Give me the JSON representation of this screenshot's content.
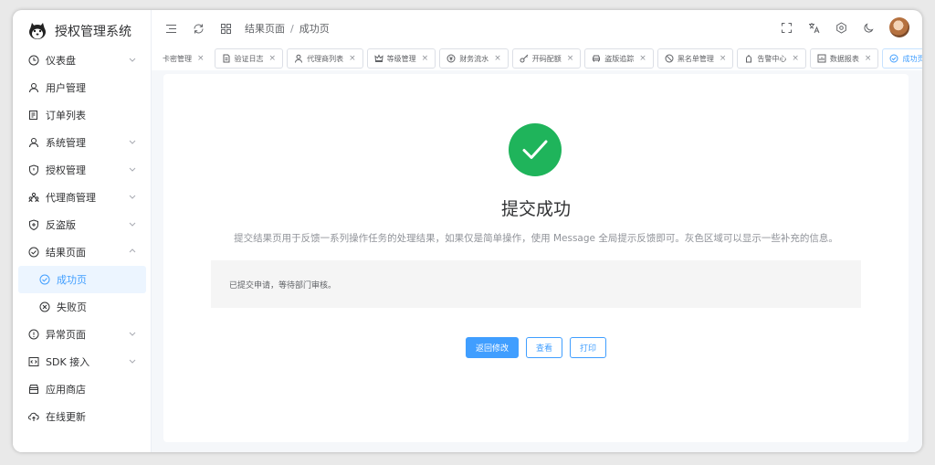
{
  "app": {
    "title": "授权管理系统"
  },
  "sidebar": {
    "items": [
      {
        "label": "仪表盘",
        "icon": "clock-icon",
        "arrow": "down"
      },
      {
        "label": "用户管理",
        "icon": "user-icon",
        "arrow": ""
      },
      {
        "label": "订单列表",
        "icon": "list-icon",
        "arrow": ""
      },
      {
        "label": "系统管理",
        "icon": "user-icon",
        "arrow": "down"
      },
      {
        "label": "授权管理",
        "icon": "shield-icon",
        "arrow": "down"
      },
      {
        "label": "代理商管理",
        "icon": "team-icon",
        "arrow": "down"
      },
      {
        "label": "反盗版",
        "icon": "shield-plus-icon",
        "arrow": "down"
      },
      {
        "label": "结果页面",
        "icon": "check-circle-icon",
        "arrow": "up"
      },
      {
        "label": "成功页",
        "icon": "check-circle-icon",
        "arrow": ""
      },
      {
        "label": "失败页",
        "icon": "close-circle-icon",
        "arrow": ""
      },
      {
        "label": "异常页面",
        "icon": "warning-circle-icon",
        "arrow": "down"
      },
      {
        "label": "SDK 接入",
        "icon": "code-icon",
        "arrow": "down"
      },
      {
        "label": "应用商店",
        "icon": "store-icon",
        "arrow": ""
      },
      {
        "label": "在线更新",
        "icon": "cloud-upload-icon",
        "arrow": ""
      }
    ]
  },
  "header": {
    "breadcrumb": [
      "结果页面",
      "成功页"
    ]
  },
  "tabs": [
    {
      "label": "卡密管理"
    },
    {
      "label": "验证日志"
    },
    {
      "label": "代理商列表"
    },
    {
      "label": "等级管理"
    },
    {
      "label": "财务流水"
    },
    {
      "label": "开码配额"
    },
    {
      "label": "盗版追踪"
    },
    {
      "label": "黑名单管理"
    },
    {
      "label": "告警中心"
    },
    {
      "label": "数据报表"
    },
    {
      "label": "成功页"
    }
  ],
  "result": {
    "title": "提交成功",
    "subtitle": "提交结果页用于反馈一系列操作任务的处理结果，如果仅是简单操作，使用 Message 全局提示反馈即可。灰色区域可以显示一些补充的信息。",
    "extra": "已提交申请，等待部门审核。",
    "buttons": {
      "back": "返回修改",
      "view": "查看",
      "print": "打印"
    }
  },
  "colors": {
    "primary": "#409eff",
    "success": "#1fb45b"
  }
}
